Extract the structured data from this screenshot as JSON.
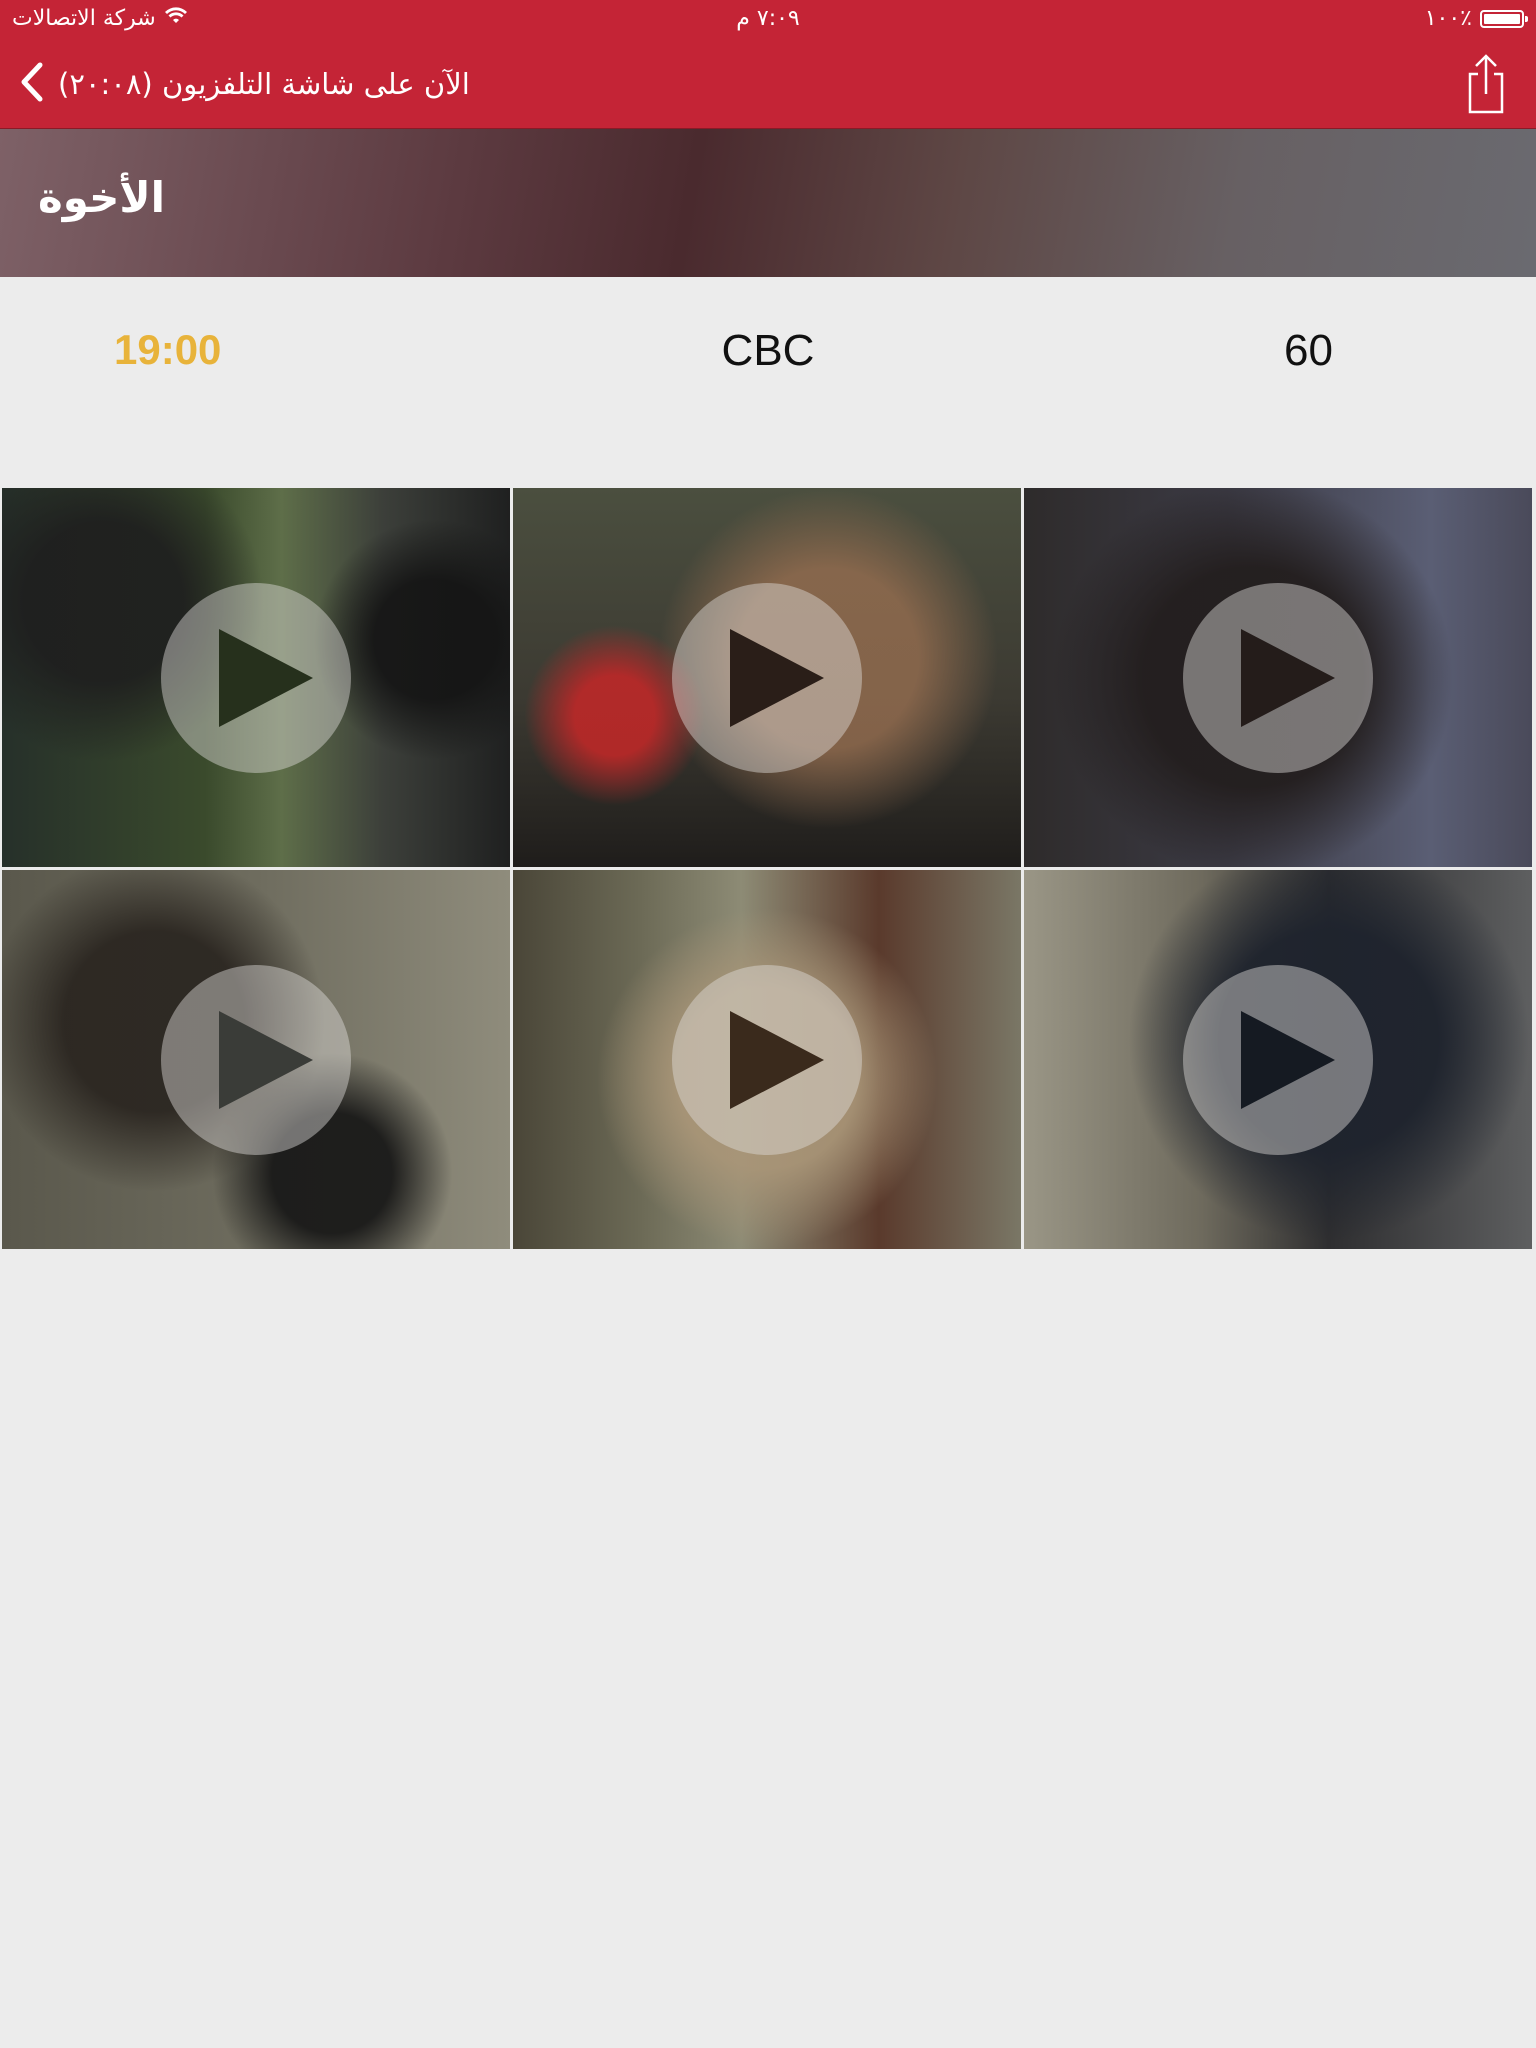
{
  "status_bar": {
    "carrier": "شركة الاتصالات",
    "time": "٧:٠٩ م",
    "battery": "١٠٠٪"
  },
  "nav": {
    "back_title": "الآن على شاشة التلفزيون (٢٠:٠٨)",
    "share_icon": "share-icon",
    "back_icon": "chevron-left-icon"
  },
  "program": {
    "title": "الأخوة",
    "start_time": "19:00",
    "channel": "CBC",
    "duration": "60"
  },
  "videos": [
    {
      "icon": "play-icon"
    },
    {
      "icon": "play-icon"
    },
    {
      "icon": "play-icon"
    },
    {
      "icon": "play-icon"
    },
    {
      "icon": "play-icon"
    },
    {
      "icon": "play-icon"
    }
  ],
  "colors": {
    "brand_red": "#c42436",
    "time_accent": "#e8b33a",
    "background": "#ececec"
  }
}
